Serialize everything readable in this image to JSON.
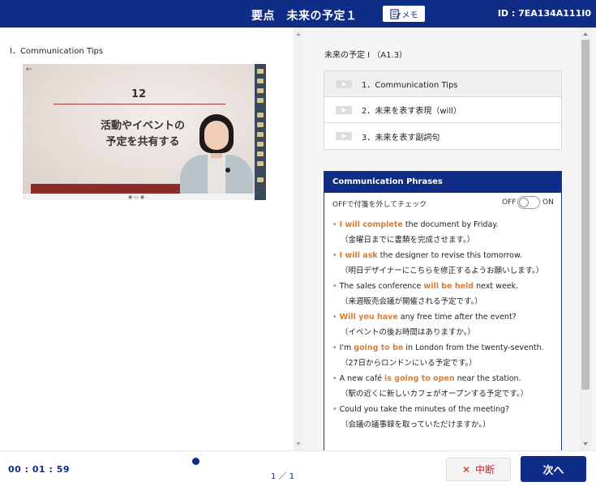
{
  "header": {
    "title": "要点　未来の予定１",
    "memo_label": "メモ",
    "id_text": "ID : 7EA134A111I0"
  },
  "left": {
    "title": "I．Communication Tips",
    "slide": {
      "number": "12",
      "text": "活動やイベントの\n予定を共有する"
    }
  },
  "right": {
    "lesson_title": "未来の予定 I （A1.3）",
    "chapters": [
      {
        "label": "1．Communication Tips",
        "active": true
      },
      {
        "label": "2．未来を表す表現（will）",
        "active": false
      },
      {
        "label": "3．未来を表す副詞句",
        "active": false
      }
    ],
    "phrases": {
      "header": "Communication Phrases",
      "instruction": "OFFで付箋を外してチェック",
      "off_label": "OFF",
      "on_label": "ON",
      "items": [
        {
          "pre": "",
          "hl": "I will complete",
          "post": " the document by Friday.",
          "ja": "（金曜日までに書類を完成させます。）"
        },
        {
          "pre": "",
          "hl": "I will ask",
          "post": " the designer to revise this tomorrow.",
          "ja": "（明日デザイナーにこちらを修正するようお願いします。）"
        },
        {
          "pre": "The sales conference ",
          "hl": "will be held",
          "post": " next week.",
          "ja": "（来週販売会議が開催される予定です。）"
        },
        {
          "pre": "",
          "hl": "Will you have",
          "post": " any free time after the event?",
          "ja": "（イベントの後お時間はありますか。）"
        },
        {
          "pre": "I'm ",
          "hl": "going to be",
          "post": " in London from the twenty-seventh.",
          "ja": "（27日からロンドンにいる予定です。）"
        },
        {
          "pre": "A new café ",
          "hl": "is going to open",
          "post": " near the station.",
          "ja": "（駅の近くに新しいカフェがオープンする予定です。）"
        },
        {
          "pre": "Could you take the minutes of the meeting?",
          "hl": "",
          "post": "",
          "ja": "（会議の議事録を取っていただけますか。）"
        }
      ]
    }
  },
  "bottom": {
    "timer": "00 : 01 : 59",
    "page_count": "1 ／ 1",
    "stop_label": "中断",
    "next_label": "次へ"
  },
  "colors": {
    "brand": "#0f2c87",
    "highlight": "#e07a2e",
    "stop": "#c62828"
  }
}
